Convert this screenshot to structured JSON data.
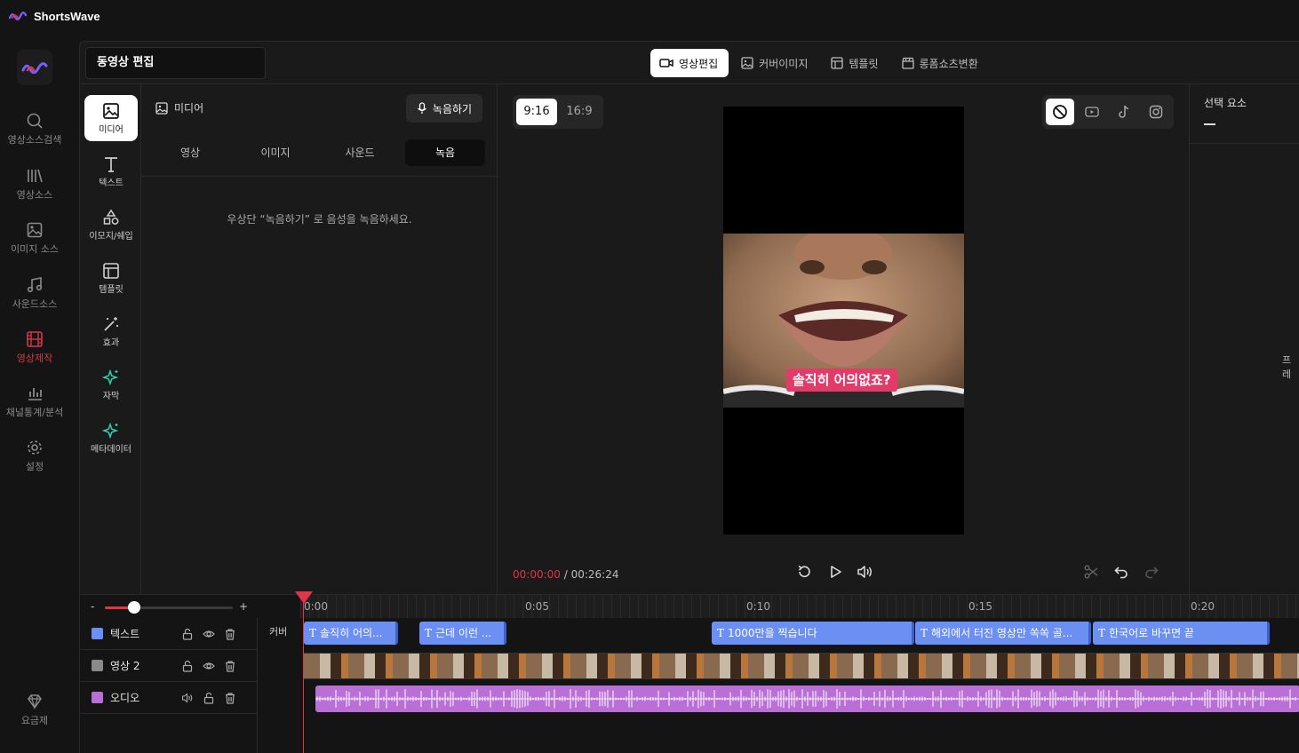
{
  "app": {
    "title": "ShortsWave",
    "accent": "#e0354a"
  },
  "nav": {
    "items": [
      {
        "label": "영상소스검색",
        "icon": "search-icon"
      },
      {
        "label": "영상소스",
        "icon": "library-icon"
      },
      {
        "label": "이미지 소스",
        "icon": "image-icon"
      },
      {
        "label": "사운드소스",
        "icon": "music-icon"
      },
      {
        "label": "영상제작",
        "icon": "film-icon",
        "active": true
      },
      {
        "label": "채널통계/분석",
        "icon": "bar-chart-icon"
      },
      {
        "label": "설정",
        "icon": "gear-icon"
      }
    ],
    "pricing_label": "요금제"
  },
  "header": {
    "project_name": "동영상 편집",
    "tabs": [
      {
        "label": "영상편집",
        "active": true
      },
      {
        "label": "커버이미지"
      },
      {
        "label": "템플릿"
      },
      {
        "label": "롱폼쇼츠변환"
      }
    ]
  },
  "tools": [
    {
      "label": "미디어",
      "active": true
    },
    {
      "label": "텍스트"
    },
    {
      "label": "이모지/쉐입"
    },
    {
      "label": "템플릿"
    },
    {
      "label": "효과"
    },
    {
      "label": "자막"
    },
    {
      "label": "메타데이터"
    }
  ],
  "media_panel": {
    "title": "미디어",
    "record_button": "녹음하기",
    "subtabs": [
      {
        "label": "영상"
      },
      {
        "label": "이미지"
      },
      {
        "label": "사운드"
      },
      {
        "label": "녹음",
        "active": true
      }
    ],
    "empty_message": "우상단 “녹음하기” 로 음성을 녹음하세요."
  },
  "preview": {
    "ratios": [
      {
        "label": "9:16",
        "active": true
      },
      {
        "label": "16:9"
      }
    ],
    "platforms": [
      {
        "icon": "ban-icon",
        "active": true
      },
      {
        "icon": "youtube-icon"
      },
      {
        "icon": "tiktok-icon"
      },
      {
        "icon": "instagram-icon"
      }
    ],
    "caption": "솔직히 어의없죠?",
    "time_current": "00:00:00",
    "time_total": " / 00:26:24"
  },
  "right_panel": {
    "title": "선택 요소",
    "side_text": "프레"
  },
  "timeline": {
    "zoom_minus": "-",
    "zoom_plus": "+",
    "zoom_level": 0.25,
    "ticks": [
      "0:00",
      "0:05",
      "0:10",
      "0:15",
      "0:20"
    ],
    "cover_label": "커버",
    "tracks": [
      {
        "name": "텍스트",
        "color": "#6b8ff2"
      },
      {
        "name": "영상 2",
        "color": "#8a8a8a"
      },
      {
        "name": "오디오",
        "color": "#b96fd6"
      }
    ],
    "text_clips": [
      "솔직히 어의...",
      "근데 이런 ...",
      "1000만을 찍습니다",
      "해외에서 터진 영상만 쏙쏙 골...",
      "한국어로 바꾸면 끝"
    ]
  }
}
